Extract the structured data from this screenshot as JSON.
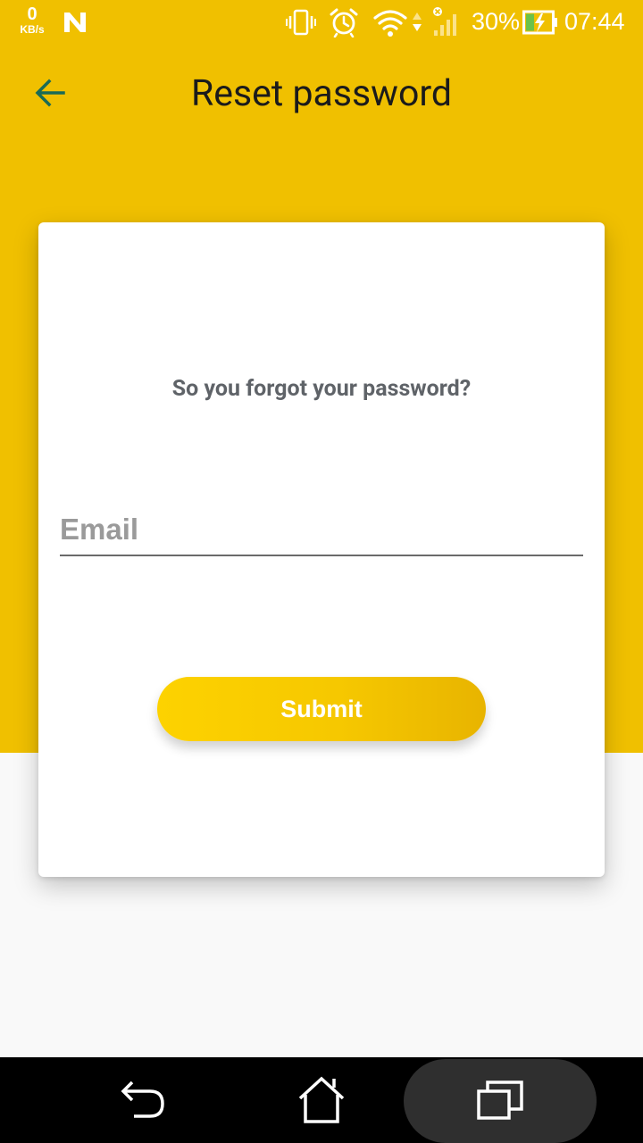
{
  "status_bar": {
    "net_speed_value": "0",
    "net_speed_unit": "KB/s",
    "notification_icon": "n-icon",
    "icons": [
      "vibrate-icon",
      "alarm-icon",
      "wifi-icon",
      "signal-icon",
      "battery-icon"
    ],
    "battery_percent": "30%",
    "time": "07:44"
  },
  "app_bar": {
    "back_icon": "arrow-left-icon",
    "title": "Reset password"
  },
  "form": {
    "subtitle": "So you forgot your password?",
    "email_placeholder": "Email",
    "email_value": "",
    "submit_label": "Submit"
  },
  "nav_bar": {
    "buttons": [
      "back-icon",
      "home-icon",
      "recent-apps-icon"
    ]
  },
  "colors": {
    "accent": "#f0c000",
    "back_arrow": "#1a6b55",
    "card": "#ffffff",
    "background": "#f9f9f9"
  }
}
